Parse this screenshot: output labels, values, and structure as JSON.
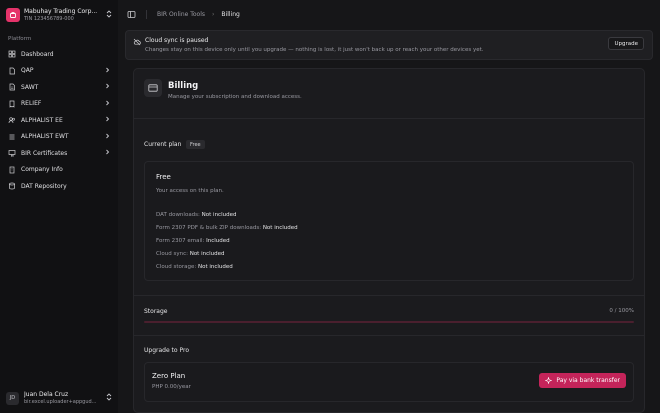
{
  "sidebar": {
    "org_name": "Mabuhay Trading Corp...",
    "org_tin": "TIN 123456789-000",
    "section_label": "Platform",
    "items": [
      {
        "label": "Dashboard",
        "has_children": false
      },
      {
        "label": "QAP",
        "has_children": true
      },
      {
        "label": "SAWT",
        "has_children": true
      },
      {
        "label": "RELIEF",
        "has_children": true
      },
      {
        "label": "ALPHALIST EE",
        "has_children": true
      },
      {
        "label": "ALPHALIST EWT",
        "has_children": true
      },
      {
        "label": "BIR Certificates",
        "has_children": true
      },
      {
        "label": "Company Info",
        "has_children": false
      },
      {
        "label": "DAT Repository",
        "has_children": false
      }
    ],
    "user": {
      "initials": "JD",
      "name": "Juan Dela Cruz",
      "email": "bir.excel.uploader+appgud..."
    }
  },
  "breadcrumb": {
    "parent": "BIR Online Tools",
    "current": "Billing"
  },
  "banner": {
    "title": "Cloud sync is paused",
    "description": "Changes stay on this device only until you upgrade — nothing is lost, it just won't back up or reach your other devices yet.",
    "button_label": "Upgrade"
  },
  "billing": {
    "title": "Billing",
    "subtitle": "Manage your subscription and download access.",
    "current_plan_label": "Current plan",
    "current_plan_badge": "Free",
    "plan": {
      "name": "Free",
      "description": "Your access on this plan.",
      "features": [
        {
          "label": "DAT downloads:",
          "value": "Not included"
        },
        {
          "label": "Form 2307 PDF & bulk ZIP downloads:",
          "value": "Not included"
        },
        {
          "label": "Form 2307 email:",
          "value": "Included"
        },
        {
          "label": "Cloud sync:",
          "value": "Not included"
        },
        {
          "label": "Cloud storage:",
          "value": "Not included"
        }
      ]
    },
    "storage": {
      "label": "Storage",
      "value_text": "0 / 100%",
      "percent": 0
    },
    "upgrade_label": "Upgrade to Pro",
    "zero_plan": {
      "name": "Zero Plan",
      "price": "PHP 0.00/year",
      "button_label": "Pay via bank transfer"
    }
  },
  "colors": {
    "accent": "#e5336a",
    "button_accent": "#c4245a",
    "background": "#111113",
    "panel": "#1b1b1e"
  }
}
